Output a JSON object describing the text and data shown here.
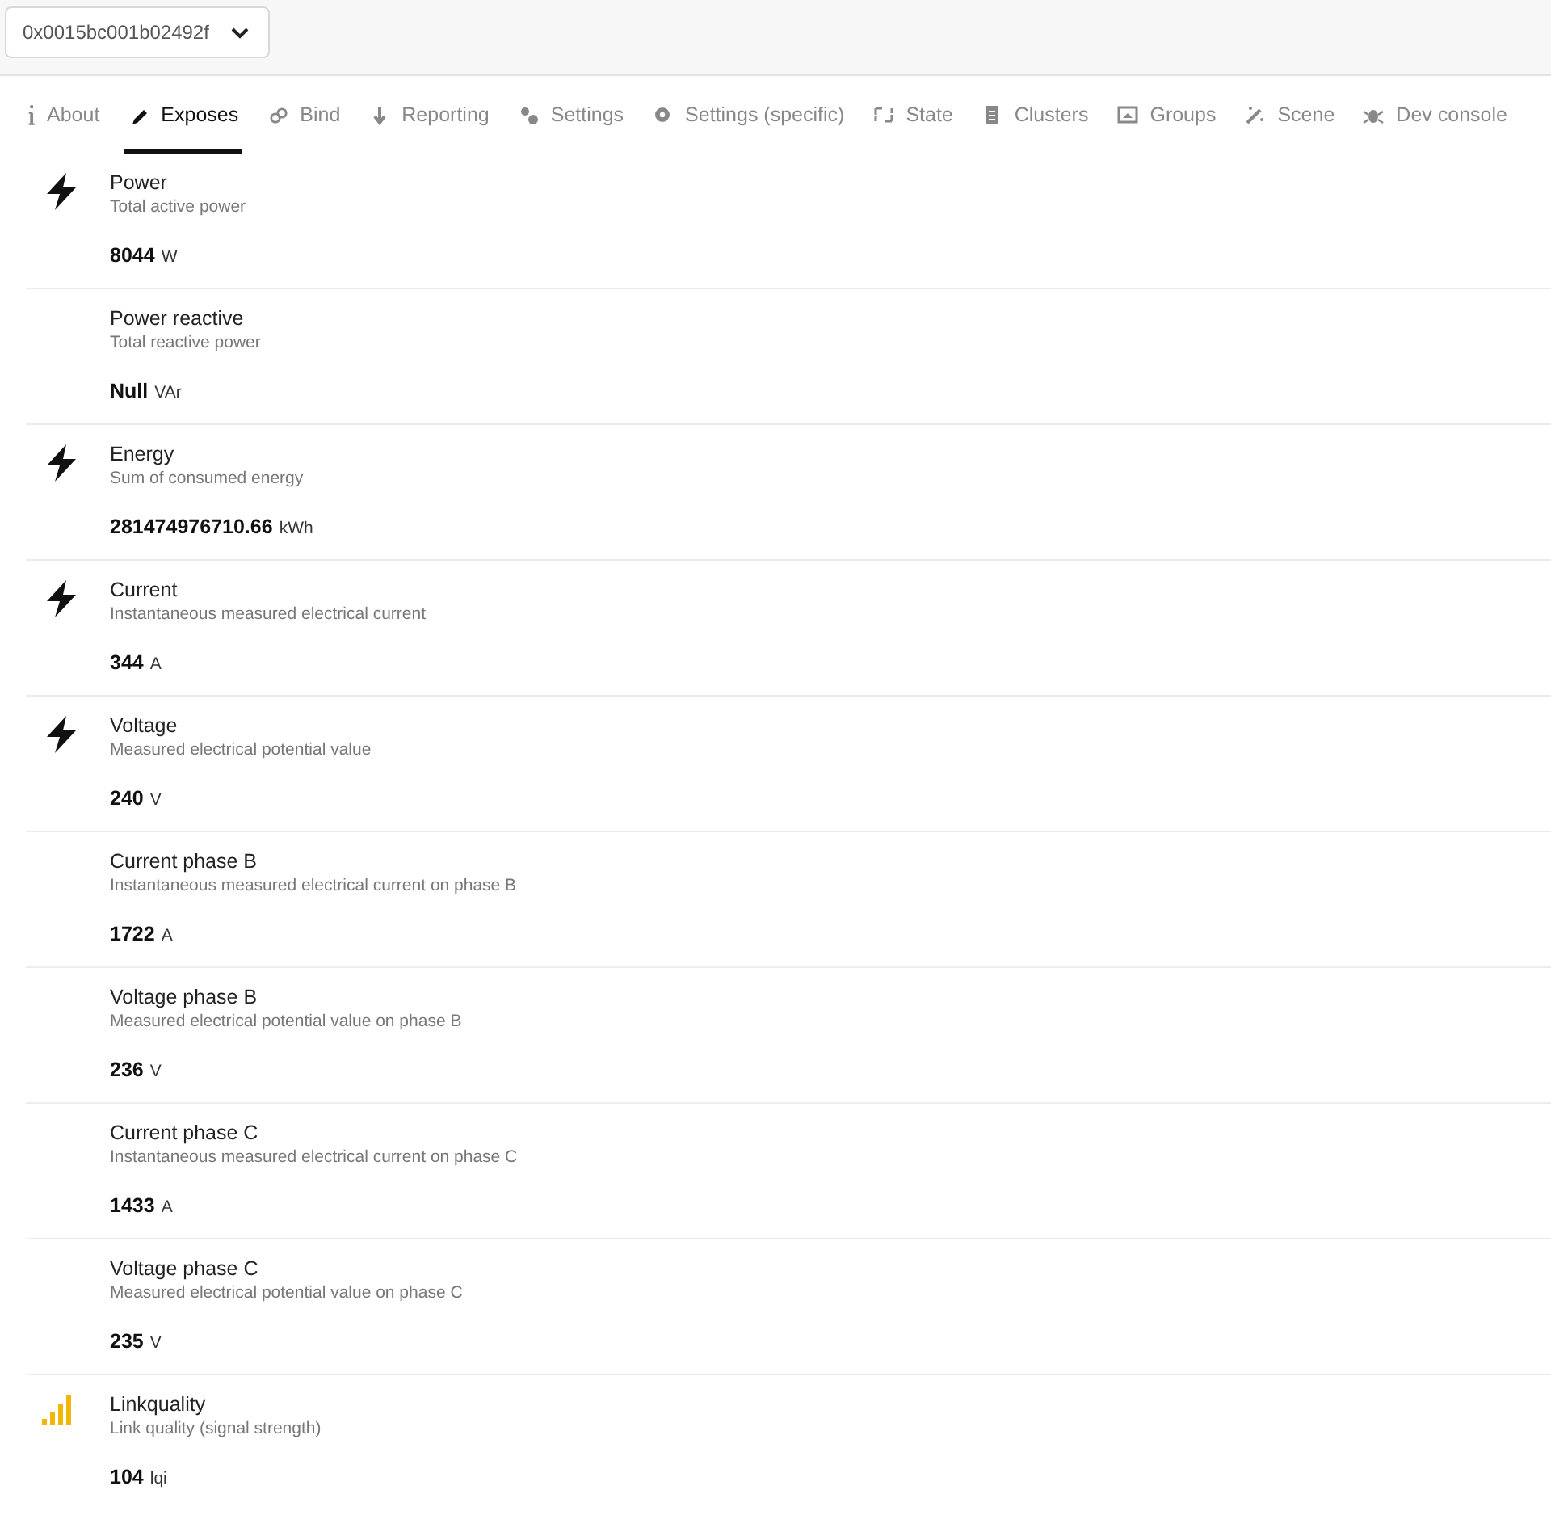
{
  "device_select": {
    "value": "0x0015bc001b02492f"
  },
  "tabs": [
    {
      "label": "About",
      "selected": false
    },
    {
      "label": "Exposes",
      "selected": true
    },
    {
      "label": "Bind",
      "selected": false
    },
    {
      "label": "Reporting",
      "selected": false
    },
    {
      "label": "Settings",
      "selected": false
    },
    {
      "label": "Settings (specific)",
      "selected": false
    },
    {
      "label": "State",
      "selected": false
    },
    {
      "label": "Clusters",
      "selected": false
    },
    {
      "label": "Groups",
      "selected": false
    },
    {
      "label": "Scene",
      "selected": false
    },
    {
      "label": "Dev console",
      "selected": false
    }
  ],
  "exposes": [
    {
      "kind": "bolt",
      "name": "Power",
      "description": "Total active power",
      "value": "8044",
      "unit": "W"
    },
    {
      "kind": "plain",
      "name": "Power reactive",
      "description": "Total reactive power",
      "value": "Null",
      "unit": "VAr"
    },
    {
      "kind": "bolt",
      "name": "Energy",
      "description": "Sum of consumed energy",
      "value": "281474976710.66",
      "unit": "kWh"
    },
    {
      "kind": "bolt",
      "name": "Current",
      "description": "Instantaneous measured electrical current",
      "value": "344",
      "unit": "A"
    },
    {
      "kind": "bolt",
      "name": "Voltage",
      "description": "Measured electrical potential value",
      "value": "240",
      "unit": "V"
    },
    {
      "kind": "plain",
      "name": "Current phase B",
      "description": "Instantaneous measured electrical current on phase B",
      "value": "1722",
      "unit": "A"
    },
    {
      "kind": "plain",
      "name": "Voltage phase B",
      "description": "Measured electrical potential value on phase B",
      "value": "236",
      "unit": "V"
    },
    {
      "kind": "plain",
      "name": "Current phase C",
      "description": "Instantaneous measured electrical current on phase C",
      "value": "1433",
      "unit": "A"
    },
    {
      "kind": "plain",
      "name": "Voltage phase C",
      "description": "Measured electrical potential value on phase C",
      "value": "235",
      "unit": "V"
    },
    {
      "kind": "signal",
      "name": "Linkquality",
      "description": "Link quality (signal strength)",
      "value": "104",
      "unit": "lqi"
    }
  ]
}
